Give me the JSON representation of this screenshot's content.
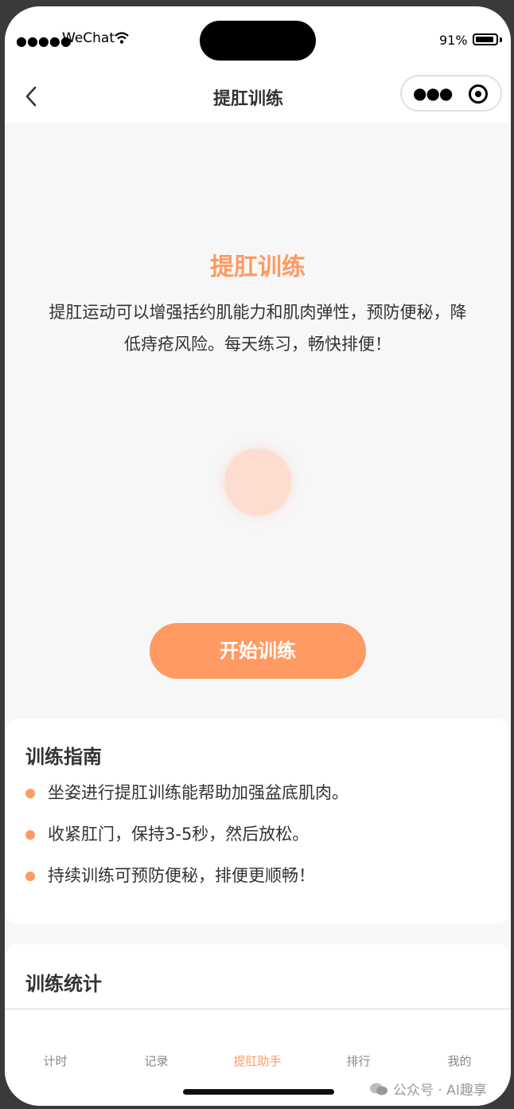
{
  "status_bar": {
    "signal": "●●●●●",
    "carrier": "WeChat",
    "battery_percent": "91%",
    "battery_level": 0.91
  },
  "navbar": {
    "title": "提肛训练",
    "menu_icon": "more-dots-icon",
    "close_icon": "target-icon"
  },
  "hero": {
    "title": "提肛训练",
    "description": "提肛运动可以增强括约肌能力和肌肉弹性，预防便秘，降低痔疮风险。每天练习，畅快排便！",
    "start_button": "开始训练"
  },
  "guide": {
    "title": "训练指南",
    "items": [
      "坐姿进行提肛训练能帮助加强盆底肌肉。",
      "收紧肛门，保持3-5秒，然后放松。",
      "持续训练可预防便秘，排便更顺畅！"
    ]
  },
  "stats": {
    "title": "训练统计"
  },
  "tabbar": {
    "tabs": [
      {
        "label": "计时"
      },
      {
        "label": "记录"
      },
      {
        "label": "提肛助手"
      },
      {
        "label": "排行"
      },
      {
        "label": "我的"
      }
    ],
    "active_index": 2
  },
  "watermark": {
    "text": "公众号 · AI趣享"
  },
  "colors": {
    "accent": "#ff9a63",
    "background": "#f7f7f7",
    "pulse": "#fcddd0"
  }
}
